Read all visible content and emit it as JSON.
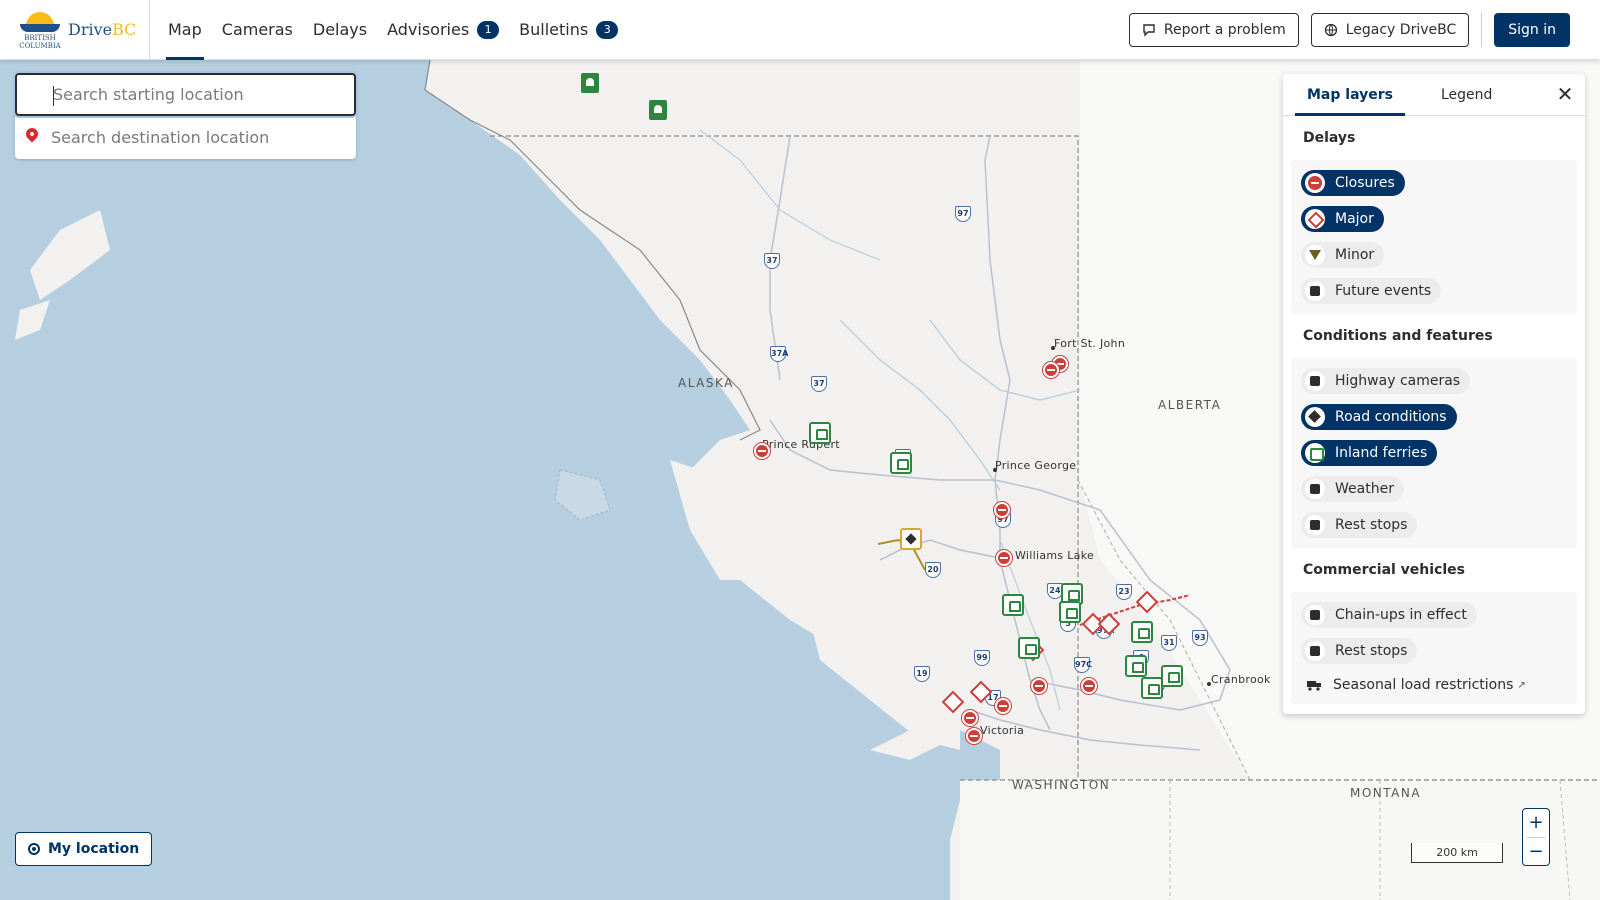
{
  "header": {
    "logo_province_line1": "BRITISH",
    "logo_province_line2": "COLUMBIA",
    "logo_drive": "Drive",
    "logo_bc": "BC",
    "nav": [
      {
        "label": "Map",
        "active": true
      },
      {
        "label": "Cameras"
      },
      {
        "label": "Delays"
      },
      {
        "label": "Advisories",
        "badge": "1"
      },
      {
        "label": "Bulletins",
        "badge": "3"
      }
    ],
    "report_problem": "Report a problem",
    "legacy": "Legacy DriveBC",
    "sign_in": "Sign in"
  },
  "search": {
    "start_placeholder": "Search starting location",
    "dest_placeholder": "Search destination location"
  },
  "map": {
    "places": [
      {
        "name": "Fort St. John"
      },
      {
        "name": "Prince Rupert"
      },
      {
        "name": "Prince George"
      },
      {
        "name": "Williams Lake"
      },
      {
        "name": "Cranbrook"
      },
      {
        "name": "Victoria"
      }
    ],
    "regions": [
      "ALASKA",
      "ALBERTA",
      "WASHINGTON",
      "MONTANA"
    ],
    "highways": [
      "97",
      "37",
      "37A",
      "37",
      "16",
      "97",
      "20",
      "24",
      "23",
      "5",
      "97A",
      "31",
      "93",
      "99",
      "97C",
      "6",
      "3A",
      "19",
      "17"
    ],
    "scale_label": "200 km"
  },
  "panel": {
    "tabs": [
      "Map layers",
      "Legend"
    ],
    "sections": [
      {
        "title": "Delays",
        "items": [
          {
            "label": "Closures",
            "on": true,
            "icon": "closure-icon"
          },
          {
            "label": "Major",
            "on": true,
            "icon": "major-delay-icon"
          },
          {
            "label": "Minor",
            "on": false,
            "icon": "minor-delay-icon"
          },
          {
            "label": "Future events",
            "on": false,
            "icon": "calendar-icon"
          }
        ]
      },
      {
        "title": "Conditions and features",
        "items": [
          {
            "label": "Highway cameras",
            "on": false,
            "icon": "camera-icon"
          },
          {
            "label": "Road conditions",
            "on": true,
            "icon": "road-conditions-icon"
          },
          {
            "label": "Inland ferries",
            "on": true,
            "icon": "ferry-icon"
          },
          {
            "label": "Weather",
            "on": false,
            "icon": "weather-icon"
          },
          {
            "label": "Rest stops",
            "on": false,
            "icon": "rest-stop-icon"
          }
        ]
      },
      {
        "title": "Commercial vehicles",
        "items": [
          {
            "label": "Chain-ups in effect",
            "on": false,
            "icon": "chain-icon"
          },
          {
            "label": "Rest stops",
            "on": false,
            "icon": "truck-rest-icon"
          }
        ],
        "link": "Seasonal load restrictions"
      }
    ]
  },
  "controls": {
    "my_location": "My location",
    "zoom_in": "+",
    "zoom_out": "−"
  },
  "colors": {
    "brand": "#013366",
    "closure": "#ce3e39",
    "ferry": "#2e8540",
    "water": "#b5cfe0",
    "land": "#f2f1f0"
  }
}
